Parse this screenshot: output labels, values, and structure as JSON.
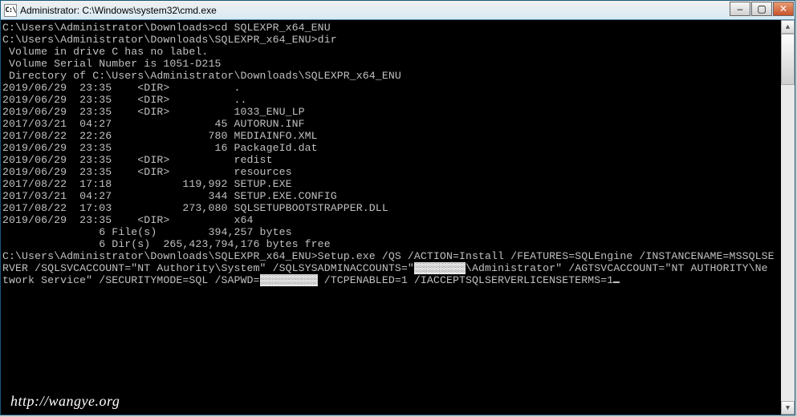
{
  "window": {
    "icon_label": "C:\\",
    "title": "Administrator: C:\\Windows\\system32\\cmd.exe"
  },
  "winbtns": {
    "minimize": "–",
    "maximize": "▢",
    "close": "✕"
  },
  "prompts": {
    "p1": "C:\\Users\\Administrator\\Downloads>",
    "cmd1": "cd SQLEXPR_x64_ENU",
    "p2": "C:\\Users\\Administrator\\Downloads\\SQLEXPR_x64_ENU>",
    "cmd2": "dir",
    "vol1": " Volume in drive C has no label.",
    "vol2": " Volume Serial Number is 1051-D215",
    "dirof": " Directory of C:\\Users\\Administrator\\Downloads\\SQLEXPR_x64_ENU",
    "rows": [
      "2019/06/29  23:35    <DIR>          .",
      "2019/06/29  23:35    <DIR>          ..",
      "2019/06/29  23:35    <DIR>          1033_ENU_LP",
      "2017/03/21  04:27                45 AUTORUN.INF",
      "2017/08/22  22:26               780 MEDIAINFO.XML",
      "2019/06/29  23:35                16 PackageId.dat",
      "2019/06/29  23:35    <DIR>          redist",
      "2019/06/29  23:35    <DIR>          resources",
      "2017/08/22  17:18           119,992 SETUP.EXE",
      "2017/03/21  04:27               344 SETUP.EXE.CONFIG",
      "2017/08/22  17:03           273,080 SQLSETUPBOOTSTRAPPER.DLL",
      "2019/06/29  23:35    <DIR>          x64"
    ],
    "sum1": "               6 File(s)        394,257 bytes",
    "sum2": "               6 Dir(s)  265,423,794,176 bytes free",
    "p3": "C:\\Users\\Administrator\\Downloads\\SQLEXPR_x64_ENU>",
    "long_a": "Setup.exe /QS /ACTION=Install /FEATURES=SQLEngine /INSTANCENAME=MSSQLSE",
    "long_b1": "RVER /SQLSVCACCOUNT=\"NT Authority\\System\" /SQLSYSADMINACCOUNTS=\"",
    "long_b_red1": "▓▓▓▓▓▓▓▓",
    "long_b2": "\\Administrator\" /AGTSVCACCOUNT=\"NT AUTHORITY\\Ne",
    "long_c1": "twork Service\" /SECURITYMODE=SQL /SAPWD=",
    "long_c_red": "▓▓▓▓▓▓▓▓▓",
    "long_c2": " /TCPENABLED=1 /IACCEPTSQLSERVERLICENSETERMS=1"
  },
  "scrollbar": {
    "up": "▲",
    "down": "▼",
    "thumb_top_pct": 0,
    "thumb_height_pct": 14
  },
  "watermark": "http://wangye.org"
}
